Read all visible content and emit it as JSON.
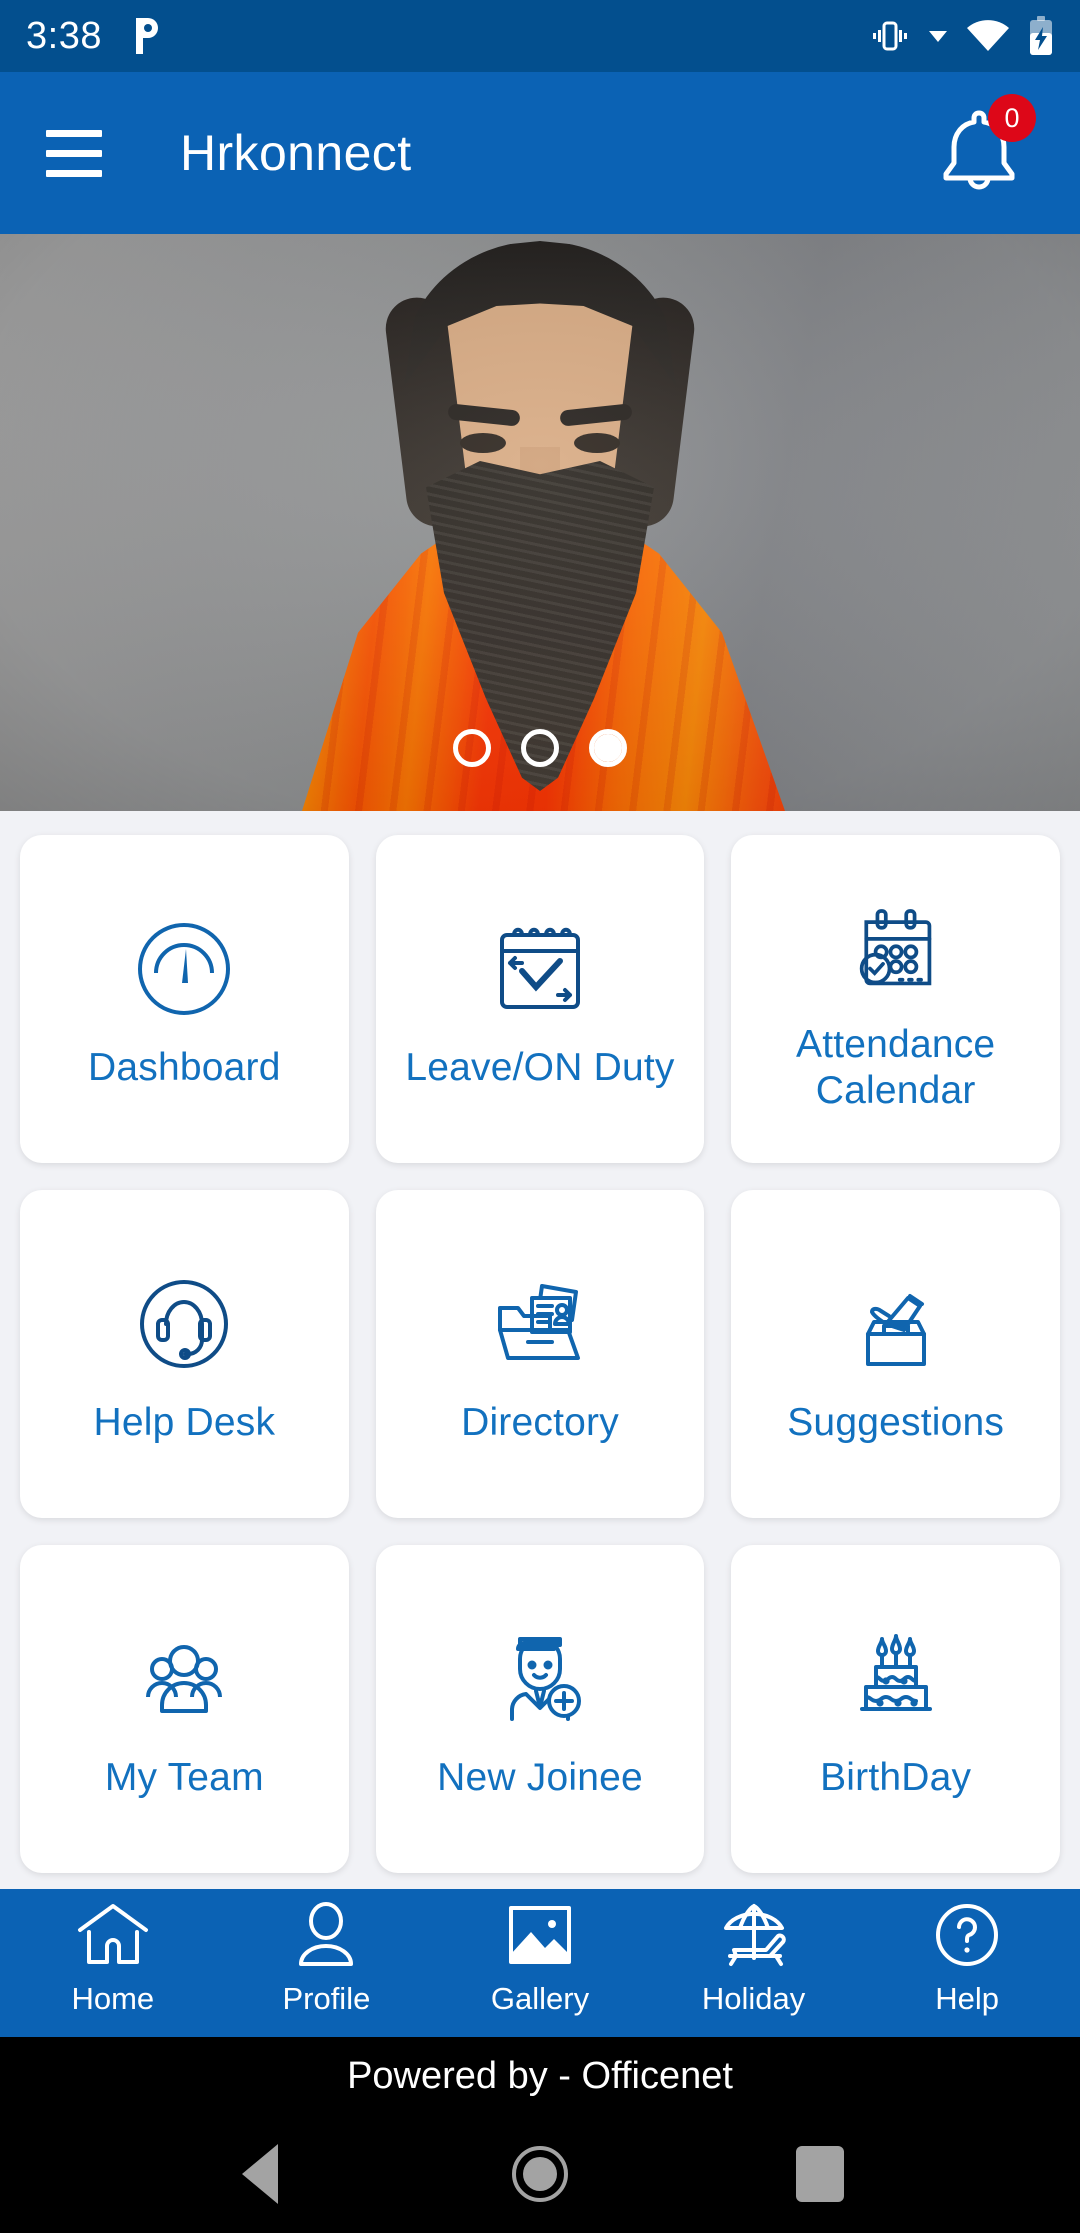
{
  "status_bar": {
    "time": "3:38",
    "app_icon": "paytm-p-icon",
    "icons": [
      "vibrate-icon",
      "dropdown-triangle-icon",
      "wifi-icon",
      "battery-charging-icon"
    ]
  },
  "app_bar": {
    "menu_icon": "hamburger-menu-icon",
    "title": "Hrkonnect",
    "notification_icon": "bell-icon",
    "notification_count": "0",
    "badge_color": "#DD0718",
    "background_color": "#0B62B4"
  },
  "hero": {
    "carousel": {
      "total_dots": 3,
      "active_index": 2
    }
  },
  "grid": {
    "background_color": "#F1F2F6",
    "tile_text_color": "#1271BF",
    "tiles": [
      {
        "label": "Dashboard",
        "icon": "speedometer-gauge-icon"
      },
      {
        "label": "Leave/ON Duty",
        "icon": "calendar-check-icon"
      },
      {
        "label": "Attendance Calendar",
        "icon": "calendar-attendance-icon"
      },
      {
        "label": "Help Desk",
        "icon": "headset-support-icon"
      },
      {
        "label": "Directory",
        "icon": "folder-documents-icon"
      },
      {
        "label": "Suggestions",
        "icon": "ballot-box-hand-icon"
      },
      {
        "label": "My Team",
        "icon": "people-group-icon"
      },
      {
        "label": "New Joinee",
        "icon": "person-add-icon"
      },
      {
        "label": "BirthDay",
        "icon": "birthday-cake-icon"
      }
    ]
  },
  "bottom_nav": {
    "background_color": "#0B62B4",
    "items": [
      {
        "label": "Home",
        "icon": "home-icon"
      },
      {
        "label": "Profile",
        "icon": "person-icon"
      },
      {
        "label": "Gallery",
        "icon": "image-icon"
      },
      {
        "label": "Holiday",
        "icon": "beach-umbrella-icon"
      },
      {
        "label": "Help",
        "icon": "question-circle-icon"
      }
    ]
  },
  "footer": {
    "text": "Powered by - Officenet"
  },
  "android_nav": {
    "items": [
      {
        "icon": "back-triangle-icon"
      },
      {
        "icon": "home-circle-icon"
      },
      {
        "icon": "recent-apps-square-icon"
      }
    ]
  }
}
